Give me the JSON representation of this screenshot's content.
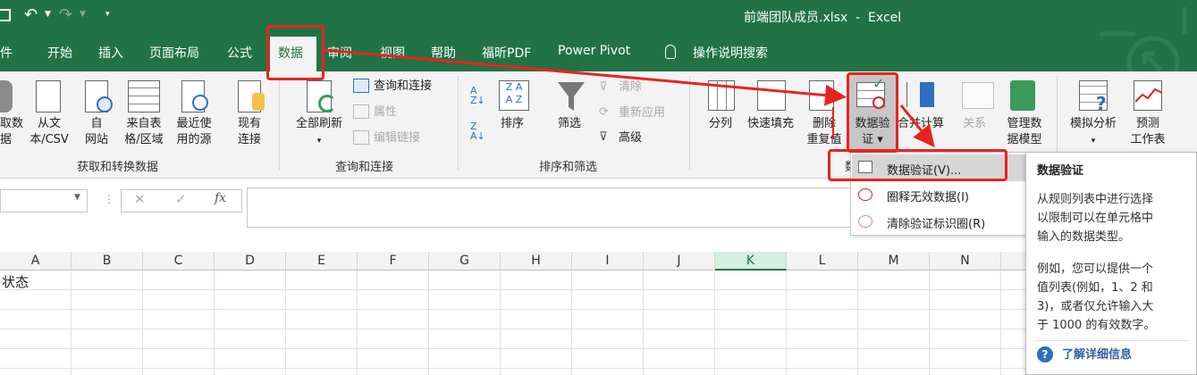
{
  "titlebar": {
    "title": "前端团队成员.xlsx  -  Excel"
  },
  "tabs": [
    "件",
    "开始",
    "插入",
    "页面布局",
    "公式",
    "数据",
    "审阅",
    "视图",
    "帮助",
    "福昕PDF",
    "Power Pivot",
    "操作说明搜索"
  ],
  "ribbon": {
    "get_data": {
      "btn1": "取数",
      "btn1b": "据",
      "btn2a": "从文",
      "btn2b": "本/CSV",
      "btn3a": "自",
      "btn3b": "网站",
      "btn4a": "来自表",
      "btn4b": "格/区域",
      "btn5a": "最近使",
      "btn5b": "用的源",
      "btn6a": "现有",
      "btn6b": "连接",
      "group": "获取和转换数据"
    },
    "queries": {
      "refresh_a": "全部刷新",
      "refresh_b": "▾",
      "queries_connections": "查询和连接",
      "properties": "属性",
      "edit_links": "编辑链接",
      "group": "查询和连接"
    },
    "sort_filter": {
      "sort": "排序",
      "filter": "筛选",
      "clear": "清除",
      "reapply": "重新应用",
      "advanced": "高级",
      "group": "排序和筛选"
    },
    "data_tools": {
      "split": "分列",
      "flash_fill": "快速填充",
      "remove_dup_a": "删除",
      "remove_dup_b": "重复值",
      "validation_a": "数据验",
      "validation_b": "证 ▾",
      "consolidate": "合并计算",
      "relationships": "关系",
      "model_a": "管理数",
      "model_b": "据模型"
    },
    "forecast": {
      "whatif_a": "模拟分析",
      "whatif_b": "▾",
      "forecast_a": "预测",
      "forecast_b": "工作表"
    },
    "group_partial": "数"
  },
  "formula": {
    "cancel": "✕",
    "enter": "✓",
    "fx": "fx"
  },
  "columns": [
    "A",
    "B",
    "C",
    "D",
    "E",
    "F",
    "G",
    "H",
    "I",
    "J",
    "K",
    "L",
    "M",
    "N"
  ],
  "cell_a1": "状态",
  "dropdown": {
    "item1": "数据验证(V)...",
    "item2": "圈释无效数据(I)",
    "item3": "清除验证标识圈(R)"
  },
  "tooltip": {
    "title": "数据验证",
    "p1": [
      "从规则列表中进行选择",
      "以限制可以在单元格中",
      "输入的数据类型。"
    ],
    "p2": [
      "例如，您可以提供一个",
      "值列表(例如，1、2 和",
      "3)，或者仅允许输入大",
      "于 1000 的有效数字。"
    ],
    "link": "了解详细信息"
  },
  "colors": {
    "excel_green": "#217346",
    "annotation_red": "#e8231f",
    "selected_col": "#d3f0e0"
  }
}
